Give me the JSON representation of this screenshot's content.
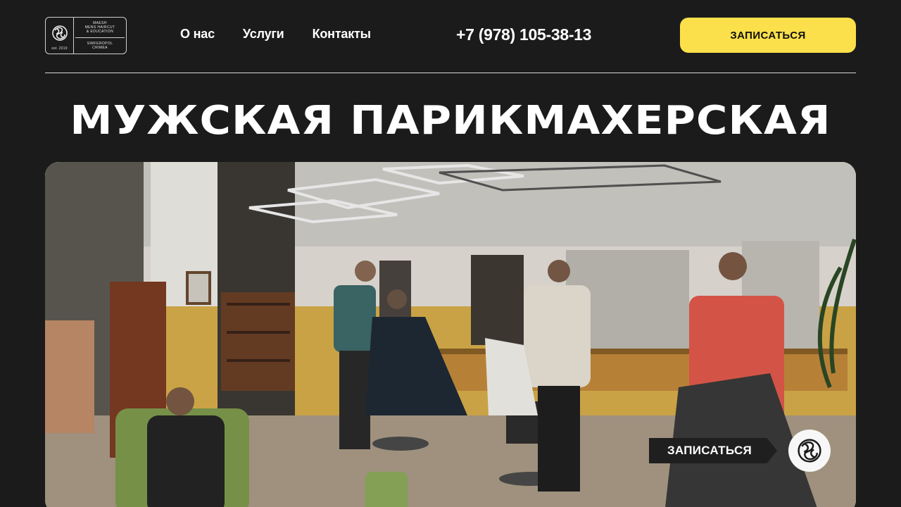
{
  "logo": {
    "brand_lines": "MAESH\nMENS HAIRCUT\n& EDUCATION",
    "city_lines": "SIMFEROPOL\nCRIMEA",
    "est": "est. 2019"
  },
  "nav": {
    "items": [
      {
        "label": "О нас"
      },
      {
        "label": "Услуги"
      },
      {
        "label": "Контакты"
      }
    ]
  },
  "phone": "+7 (978) 105-38-13",
  "cta_label": "ЗАПИСАТЬСЯ",
  "hero": {
    "title": "МУЖСКАЯ ПАРИКМАХЕРСКАЯ"
  },
  "floating": {
    "cta_label": "ЗАПИСАТЬСЯ",
    "badge_icon": "brand-logo-icon"
  },
  "colors": {
    "background": "#1b1b1b",
    "accent": "#fbe04b",
    "text": "#ffffff"
  }
}
